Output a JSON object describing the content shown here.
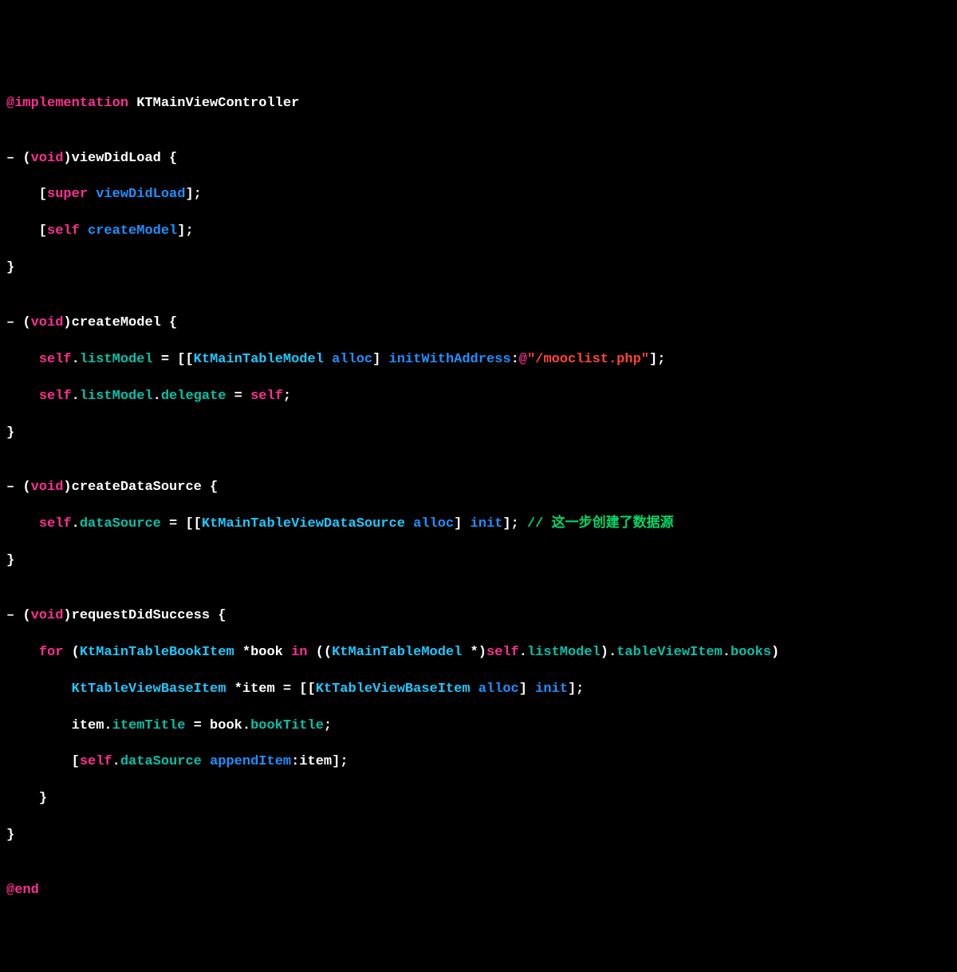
{
  "code": {
    "line01": {
      "impl": "@implementation",
      "cls": " KTMainViewController"
    },
    "line02": "",
    "line03": {
      "dash": "– ",
      "lp": "(",
      "void": "void",
      "rp": ")",
      "method": "viewDidLoad",
      "brace": " {"
    },
    "line04": {
      "indent": "    [",
      "super": "super",
      "sp": " ",
      "sel": "viewDidLoad",
      "end": "];"
    },
    "line05": {
      "indent": "    [",
      "self": "self",
      "sp": " ",
      "sel": "createModel",
      "end": "];"
    },
    "line06": "}",
    "line07": "",
    "line08": {
      "dash": "– ",
      "lp": "(",
      "void": "void",
      "rp": ")",
      "method": "createModel",
      "brace": " {"
    },
    "line09": {
      "indent": "    ",
      "self": "self",
      "dot1": ".",
      "prop": "listModel",
      "eq": " = [[",
      "type": "KtMainTableModel",
      "sp": " ",
      "alloc": "alloc",
      "rb": "] ",
      "init": "initWithAddress",
      "colon": ":",
      "at": "@",
      "str": "\"/mooclist.php\"",
      "end": "];"
    },
    "line10": {
      "indent": "    ",
      "self": "self",
      "dot1": ".",
      "prop1": "listModel",
      "dot2": ".",
      "prop2": "delegate",
      "eq": " = ",
      "self2": "self",
      "end": ";"
    },
    "line11": "}",
    "line12": "",
    "line13": {
      "dash": "– ",
      "lp": "(",
      "void": "void",
      "rp": ")",
      "method": "createDataSource",
      "brace": " {"
    },
    "line14": {
      "indent": "    ",
      "self": "self",
      "dot": ".",
      "prop": "dataSource",
      "eq": " = [[",
      "type": "KtMainTableViewDataSource",
      "sp": " ",
      "alloc": "alloc",
      "rb": "] ",
      "init": "init",
      "end": "]; ",
      "cmt": "// 这一步创建了数据源"
    },
    "line15": "}",
    "line16": "",
    "line17": {
      "dash": "– ",
      "lp": "(",
      "void": "void",
      "rp": ")",
      "method": "requestDidSuccess",
      "brace": " {"
    },
    "line18": {
      "indent": "    ",
      "for": "for",
      "sp1": " (",
      "type1": "KtMainTableBookItem",
      "sp2": " *book ",
      "in": "in",
      "sp3": " ((",
      "type2": "KtMainTableModel",
      "sp4": " *)",
      "self": "self",
      "dot1": ".",
      "prop1": "listModel",
      "rp": ").",
      "prop2": "tableViewItem",
      "dot2": ".",
      "prop3": "books",
      "end": ")"
    },
    "line19": {
      "indent": "        ",
      "type": "KtTableViewBaseItem",
      "sp": " *item = [[",
      "type2": "KtTableViewBaseItem",
      "sp2": " ",
      "alloc": "alloc",
      "rb": "] ",
      "init": "init",
      "end": "];"
    },
    "line20": {
      "indent": "        item.",
      "prop1": "itemTitle",
      "eq": " = book.",
      "prop2": "bookTitle",
      "end": ";"
    },
    "line21": {
      "indent": "        [",
      "self": "self",
      "dot": ".",
      "prop": "dataSource",
      "sp": " ",
      "sel": "appendItem",
      "colon": ":item];"
    },
    "line22": "    }",
    "line23": "}",
    "line24": "",
    "line25": {
      "end": "@end"
    }
  }
}
